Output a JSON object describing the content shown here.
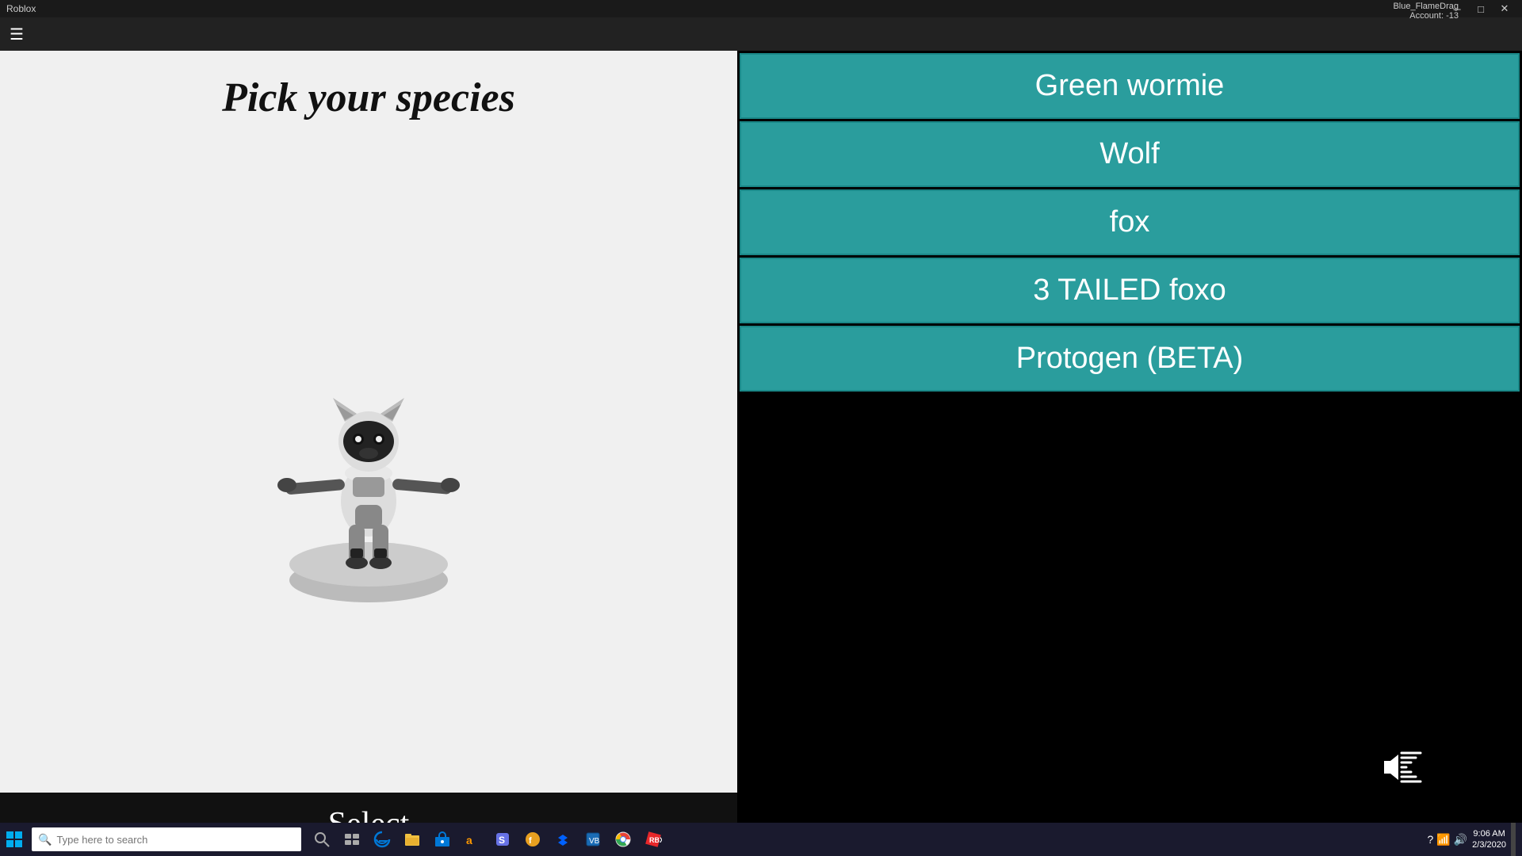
{
  "titlebar": {
    "app_name": "Roblox",
    "account_label": "Blue_FlameDrag",
    "account_info": "Account: -13",
    "minimize": "─",
    "maximize": "□",
    "close": "✕"
  },
  "toolbar": {
    "menu_icon": "☰"
  },
  "game": {
    "title": "Pick your species",
    "select_label": "Select"
  },
  "species_list": [
    {
      "id": "green-wormie",
      "label": "Green wormie"
    },
    {
      "id": "wolf",
      "label": "Wolf"
    },
    {
      "id": "fox",
      "label": "fox"
    },
    {
      "id": "3-tailed-foxo",
      "label": "3 TAILED foxo"
    },
    {
      "id": "protogen-beta",
      "label": "Protogen (BETA)"
    }
  ],
  "taskbar": {
    "search_placeholder": "Type here to search",
    "time": "9:06 AM",
    "date": "2/3/2020"
  }
}
